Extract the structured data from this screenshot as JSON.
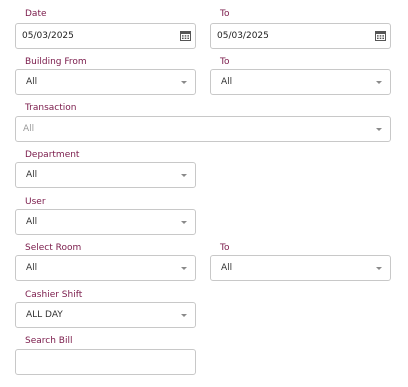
{
  "date": {
    "label": "Date",
    "value": "05/03/2025",
    "icon": "calendar-icon"
  },
  "date_to": {
    "label": "To",
    "value": "05/03/2025",
    "icon": "calendar-icon"
  },
  "building_from": {
    "label": "Building From",
    "value": "All"
  },
  "building_to": {
    "label": "To",
    "value": "All"
  },
  "transaction": {
    "label": "Transaction",
    "value": "All"
  },
  "department": {
    "label": "Department",
    "value": "All"
  },
  "user": {
    "label": "User",
    "value": "All"
  },
  "select_room": {
    "label": "Select Room",
    "value": "All"
  },
  "room_to": {
    "label": "To",
    "value": "All"
  },
  "cashier_shift": {
    "label": "Cashier Shift",
    "value": "ALL DAY"
  },
  "search_bill": {
    "label": "Search Bill",
    "value": ""
  },
  "colors": {
    "label": "#7a1a4a",
    "border": "#c8c8c8",
    "text": "#333333"
  }
}
